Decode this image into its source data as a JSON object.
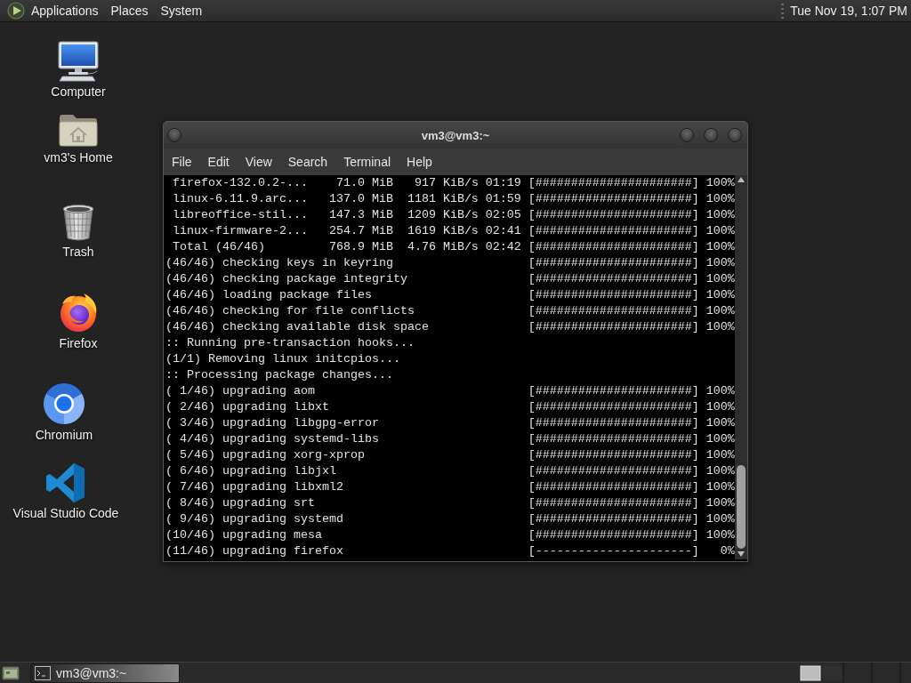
{
  "top_panel": {
    "menus": [
      "Applications",
      "Places",
      "System"
    ],
    "clock": "Tue Nov 19, 1:07 PM"
  },
  "desktop_icons": [
    {
      "kind": "computer",
      "label": "Computer"
    },
    {
      "kind": "home",
      "label": "vm3's Home"
    },
    {
      "kind": "trash",
      "label": "Trash"
    },
    {
      "kind": "firefox",
      "label": "Firefox"
    },
    {
      "kind": "chromium",
      "label": "Chromium"
    },
    {
      "kind": "vscode",
      "label": "Visual Studio Code"
    }
  ],
  "terminal_window": {
    "title": "vm3@vm3:~",
    "menu": [
      "File",
      "Edit",
      "View",
      "Search",
      "Terminal",
      "Help"
    ],
    "lines": [
      {
        "kind": "download",
        "name": "firefox-132.0.2-...",
        "size": "71.0 MiB",
        "rate": "917 KiB/s",
        "eta": "01:19",
        "progress": "[######################]",
        "percent": "100%"
      },
      {
        "kind": "download",
        "name": "linux-6.11.9.arc...",
        "size": "137.0 MiB",
        "rate": "1181 KiB/s",
        "eta": "01:59",
        "progress": "[######################]",
        "percent": "100%"
      },
      {
        "kind": "download",
        "name": "libreoffice-stil...",
        "size": "147.3 MiB",
        "rate": "1209 KiB/s",
        "eta": "02:05",
        "progress": "[######################]",
        "percent": "100%"
      },
      {
        "kind": "download",
        "name": "linux-firmware-2...",
        "size": "254.7 MiB",
        "rate": "1619 KiB/s",
        "eta": "02:41",
        "progress": "[######################]",
        "percent": "100%"
      },
      {
        "kind": "download",
        "name": "Total (46/46)",
        "size": "768.9 MiB",
        "rate": "4.76 MiB/s",
        "eta": "02:42",
        "progress": "[######################]",
        "percent": "100%"
      },
      {
        "kind": "step",
        "text": "(46/46) checking keys in keyring",
        "progress": "[######################]",
        "percent": "100%"
      },
      {
        "kind": "step",
        "text": "(46/46) checking package integrity",
        "progress": "[######################]",
        "percent": "100%"
      },
      {
        "kind": "step",
        "text": "(46/46) loading package files",
        "progress": "[######################]",
        "percent": "100%"
      },
      {
        "kind": "step",
        "text": "(46/46) checking for file conflicts",
        "progress": "[######################]",
        "percent": "100%"
      },
      {
        "kind": "step",
        "text": "(46/46) checking available disk space",
        "progress": "[######################]",
        "percent": "100%"
      },
      {
        "kind": "message",
        "text": ":: Running pre-transaction hooks..."
      },
      {
        "kind": "message",
        "text": "(1/1) Removing linux initcpios..."
      },
      {
        "kind": "message",
        "text": ":: Processing package changes..."
      },
      {
        "kind": "step",
        "text": "( 1/46) upgrading aom",
        "progress": "[######################]",
        "percent": "100%"
      },
      {
        "kind": "step",
        "text": "( 2/46) upgrading libxt",
        "progress": "[######################]",
        "percent": "100%"
      },
      {
        "kind": "step",
        "text": "( 3/46) upgrading libgpg-error",
        "progress": "[######################]",
        "percent": "100%"
      },
      {
        "kind": "step",
        "text": "( 4/46) upgrading systemd-libs",
        "progress": "[######################]",
        "percent": "100%"
      },
      {
        "kind": "step",
        "text": "( 5/46) upgrading xorg-xprop",
        "progress": "[######################]",
        "percent": "100%"
      },
      {
        "kind": "step",
        "text": "( 6/46) upgrading libjxl",
        "progress": "[######################]",
        "percent": "100%"
      },
      {
        "kind": "step",
        "text": "( 7/46) upgrading libxml2",
        "progress": "[######################]",
        "percent": "100%"
      },
      {
        "kind": "step",
        "text": "( 8/46) upgrading srt",
        "progress": "[######################]",
        "percent": "100%"
      },
      {
        "kind": "step",
        "text": "( 9/46) upgrading systemd",
        "progress": "[######################]",
        "percent": "100%"
      },
      {
        "kind": "step",
        "text": "(10/46) upgrading mesa",
        "progress": "[######################]",
        "percent": "100%"
      },
      {
        "kind": "step",
        "text": "(11/46) upgrading firefox",
        "progress": "[----------------------]",
        "percent": "0%"
      }
    ]
  },
  "taskbar": {
    "tasks": [
      {
        "label": "vm3@vm3:~",
        "selected": true
      }
    ]
  }
}
